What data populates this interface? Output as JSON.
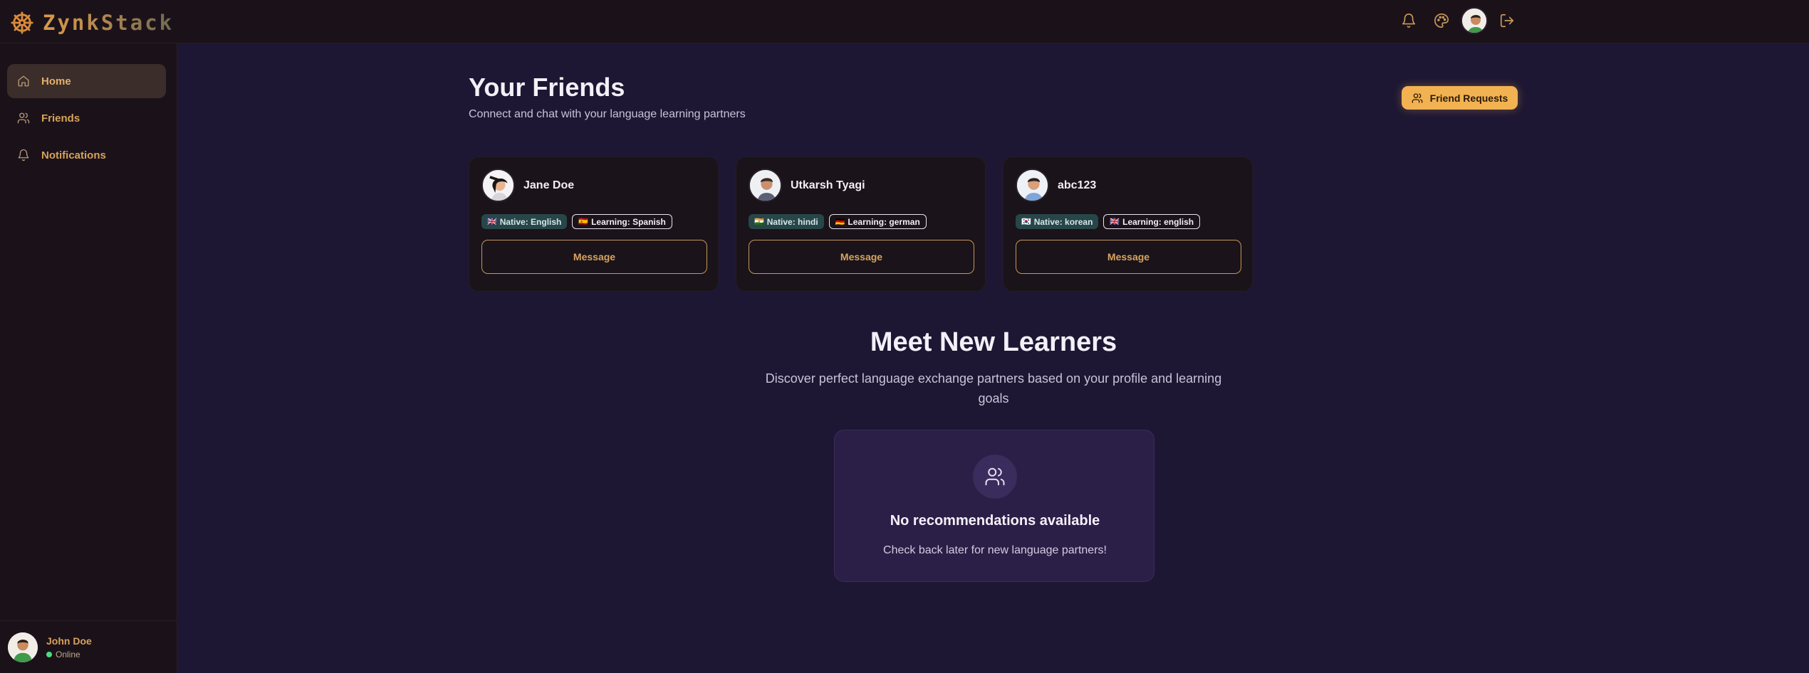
{
  "brand": {
    "name": "ZynkStack",
    "accent": "#f2b252"
  },
  "topbar": {
    "icons": [
      "bell-icon",
      "palette-icon",
      "avatar",
      "logout-icon"
    ]
  },
  "sidebar": {
    "items": [
      {
        "label": "Home",
        "icon": "home-icon",
        "active": true
      },
      {
        "label": "Friends",
        "icon": "users-icon",
        "active": false
      },
      {
        "label": "Notifications",
        "icon": "bell-icon",
        "active": false
      }
    ],
    "user": {
      "name": "John Doe",
      "status": "Online"
    }
  },
  "friends": {
    "title": "Your Friends",
    "subtitle": "Connect and chat with your language learning partners",
    "requests_label": "Friend Requests",
    "cards": [
      {
        "name": "Jane Doe",
        "native": "Native: English",
        "native_flag": "🇬🇧",
        "learning": "Learning: Spanish",
        "learning_flag": "🇪🇸",
        "button": "Message"
      },
      {
        "name": "Utkarsh Tyagi",
        "native": "Native: hindi",
        "native_flag": "🇮🇳",
        "learning": "Learning: german",
        "learning_flag": "🇩🇪",
        "button": "Message"
      },
      {
        "name": "abc123",
        "native": "Native: korean",
        "native_flag": "🇰🇷",
        "learning": "Learning: english",
        "learning_flag": "🇬🇧",
        "button": "Message"
      }
    ]
  },
  "recommend": {
    "title": "Meet New Learners",
    "subtitle": "Discover perfect language exchange partners based on your profile and learning goals",
    "empty_title": "No recommendations available",
    "empty_sub": "Check back later for new language partners!"
  }
}
